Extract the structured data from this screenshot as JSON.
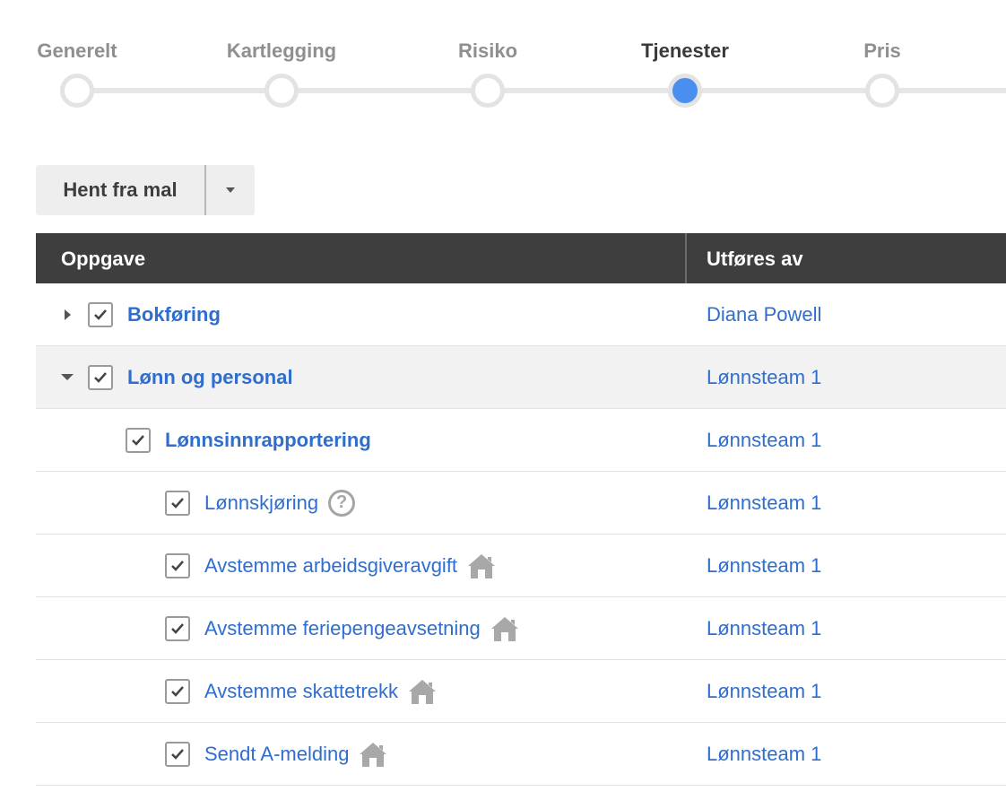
{
  "stepper": {
    "steps": [
      {
        "label": "Generelt",
        "active": false
      },
      {
        "label": "Kartlegging",
        "active": false
      },
      {
        "label": "Risiko",
        "active": false
      },
      {
        "label": "Tjenester",
        "active": true
      },
      {
        "label": "Pris",
        "active": false
      }
    ],
    "colors": {
      "active_dot": "#4a8ff0",
      "track": "#e6e6e6"
    }
  },
  "template_button": {
    "label": "Hent fra mal"
  },
  "table": {
    "headers": {
      "task": "Oppgave",
      "performed_by": "Utføres av"
    },
    "rows": [
      {
        "name": "Bokføring",
        "performed_by": "Diana Powell",
        "checked": true,
        "expander": "collapsed",
        "icon": null
      },
      {
        "name": "Lønn og personal",
        "performed_by": "Lønnsteam 1",
        "checked": true,
        "expander": "expanded",
        "icon": null
      },
      {
        "name": "Lønnsinnrapportering",
        "performed_by": "Lønnsteam 1",
        "checked": true,
        "expander": null,
        "icon": null
      },
      {
        "name": "Lønnskjøring",
        "performed_by": "Lønnsteam 1",
        "checked": true,
        "expander": null,
        "icon": "help-icon"
      },
      {
        "name": "Avstemme arbeidsgiveravgift",
        "performed_by": "Lønnsteam 1",
        "checked": true,
        "expander": null,
        "icon": "home-icon"
      },
      {
        "name": "Avstemme feriepengeavsetning",
        "performed_by": "Lønnsteam 1",
        "checked": true,
        "expander": null,
        "icon": "home-icon"
      },
      {
        "name": "Avstemme skattetrekk",
        "performed_by": "Lønnsteam 1",
        "checked": true,
        "expander": null,
        "icon": "home-icon"
      },
      {
        "name": "Sendt A-melding",
        "performed_by": "Lønnsteam 1",
        "checked": true,
        "expander": null,
        "icon": "home-icon"
      }
    ],
    "colors": {
      "header_bg": "#3e3e3e",
      "link": "#2f6ecc"
    }
  }
}
